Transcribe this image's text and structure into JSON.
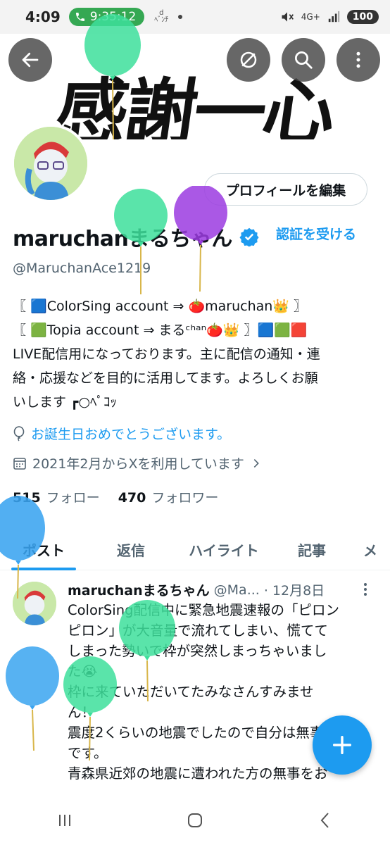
{
  "status": {
    "time": "4:09",
    "call_time": "9:35:12",
    "battery": "100",
    "net": "4G+"
  },
  "banner": {
    "text": "感謝一心"
  },
  "profile": {
    "edit_label": "プロフィールを編集",
    "display_name": "maruchanまるちゃん",
    "verify_label": "認証を受ける",
    "handle": "@MaruchanAce1219",
    "bio": [
      "〖 🟦ColorSing account ⇒ 🍅maruchan👑 〗",
      "〖 🟩Topia account ⇒ まるᶜʰᵃⁿ🍅👑 〗🟦🟩🟥",
      "LIVE配信用になっております。主に配信の通知・連",
      "絡・応援などを目的に活用してます。よろしくお願",
      "いします ┏○ﾍﾟｺｯ"
    ],
    "birthday": "お誕生日おめでとうございます。",
    "joined": "2021年2月からXを利用しています",
    "following_count": "515",
    "following_label": "フォロー",
    "followers_count": "470",
    "followers_label": "フォロワー"
  },
  "tabs": [
    "ポスト",
    "返信",
    "ハイライト",
    "記事",
    "メ"
  ],
  "post": {
    "name": "maruchanまるちゃん",
    "handle": "@Ma...",
    "date": "· 12月8日",
    "lines": [
      "ColorSing配信中に緊急地震速報の「ピロン",
      "ピロン」が大音量で流れてしまい、慌てて",
      "しまった勢いで枠が突然しまっちゃいまし",
      "た😭",
      "枠に来ていただいてたみなさんすみませ",
      "ん！",
      "震度2くらいの地震でしたので自分は無事",
      "です。",
      "青森県近郊の地震に遭われた方の無事をお"
    ]
  },
  "colors": {
    "accent": "#1d9bf0",
    "balloon_green": "#3ddf9b",
    "balloon_purple": "#9b3be0",
    "balloon_blue": "#3aa4f0"
  }
}
